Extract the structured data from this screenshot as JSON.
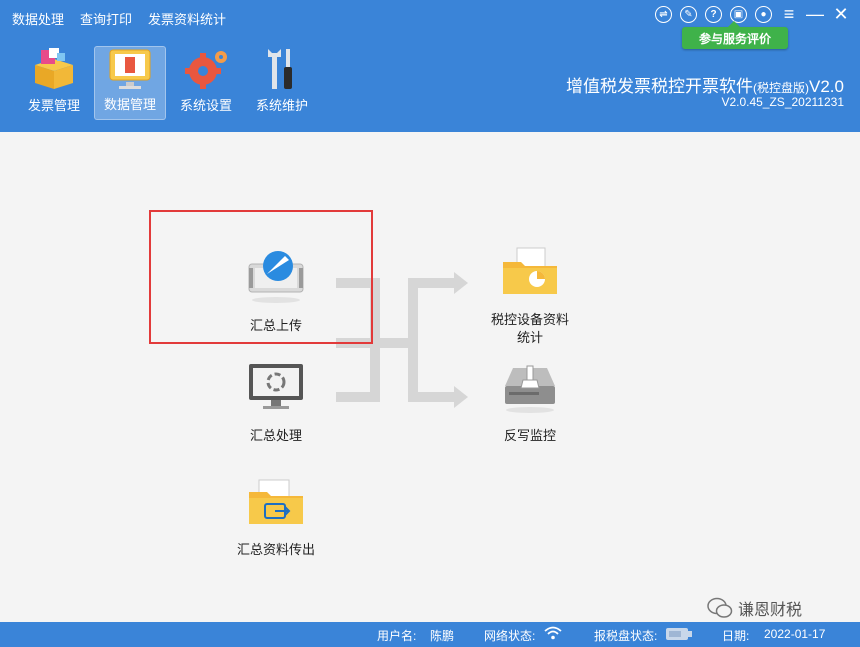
{
  "menu": [
    "数据处理",
    "查询打印",
    "发票资料统计"
  ],
  "rate_button": "参与服务评价",
  "toolbar": [
    {
      "label": "发票管理",
      "active": false
    },
    {
      "label": "数据管理",
      "active": true
    },
    {
      "label": "系统设置",
      "active": false
    },
    {
      "label": "系统维护",
      "active": false
    }
  ],
  "app": {
    "title_main": "增值税发票税控开票软件",
    "title_sub": "(税控盘版)",
    "title_ver": "V2.0",
    "version": "V2.0.45_ZS_20211231"
  },
  "functions": {
    "upload": "汇总上传",
    "process": "汇总处理",
    "export": "汇总资料传出",
    "stats_line1": "税控设备资料",
    "stats_line2": "统计",
    "monitor": "反写监控"
  },
  "status": {
    "user_label": "用户名:",
    "user_value": "陈鹏",
    "network_label": "网络状态:",
    "disk_label": "报税盘状态:",
    "date_label": "日期:",
    "date_value": "2022-01-17"
  },
  "watermark": "谦恩财税",
  "colors": {
    "header": "#3a84d8",
    "highlight": "#e23a3a",
    "rate": "#3fb24a"
  }
}
